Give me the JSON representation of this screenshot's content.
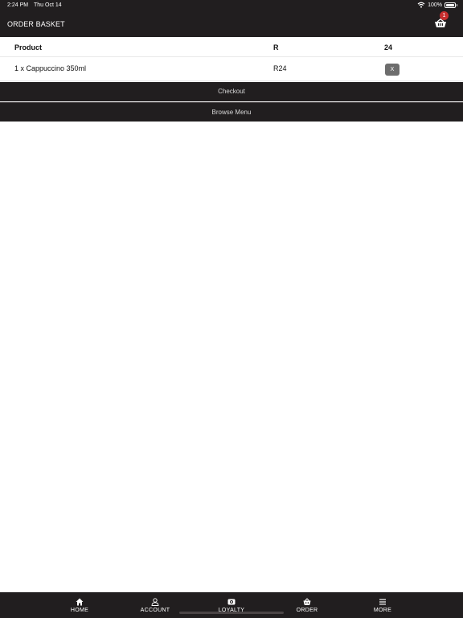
{
  "status_bar": {
    "time": "2:24 PM",
    "date": "Thu Oct 14",
    "battery": "100%"
  },
  "header": {
    "title": "ORDER BASKET",
    "cart_count": "1",
    "cart_icon": "basket-icon"
  },
  "table": {
    "columns": [
      "Product",
      "R",
      "24"
    ],
    "rows": [
      {
        "product": "1 x Cappuccino 350ml",
        "price": "R24",
        "remove_label": "X"
      }
    ]
  },
  "actions": {
    "checkout": "Checkout",
    "browse": "Browse Menu"
  },
  "tab_bar": {
    "tabs": [
      {
        "label": "HOME",
        "icon": "home-icon"
      },
      {
        "label": "ACCOUNT",
        "icon": "user-icon"
      },
      {
        "label": "LOYALTY",
        "icon": "loyalty-card-icon"
      },
      {
        "label": "ORDER",
        "icon": "basket-icon"
      },
      {
        "label": "MORE",
        "icon": "menu-icon"
      }
    ]
  },
  "colors": {
    "bar_background": "#211e1f",
    "badge": "#c62e2e",
    "remove_button": "#6d6d6d"
  }
}
